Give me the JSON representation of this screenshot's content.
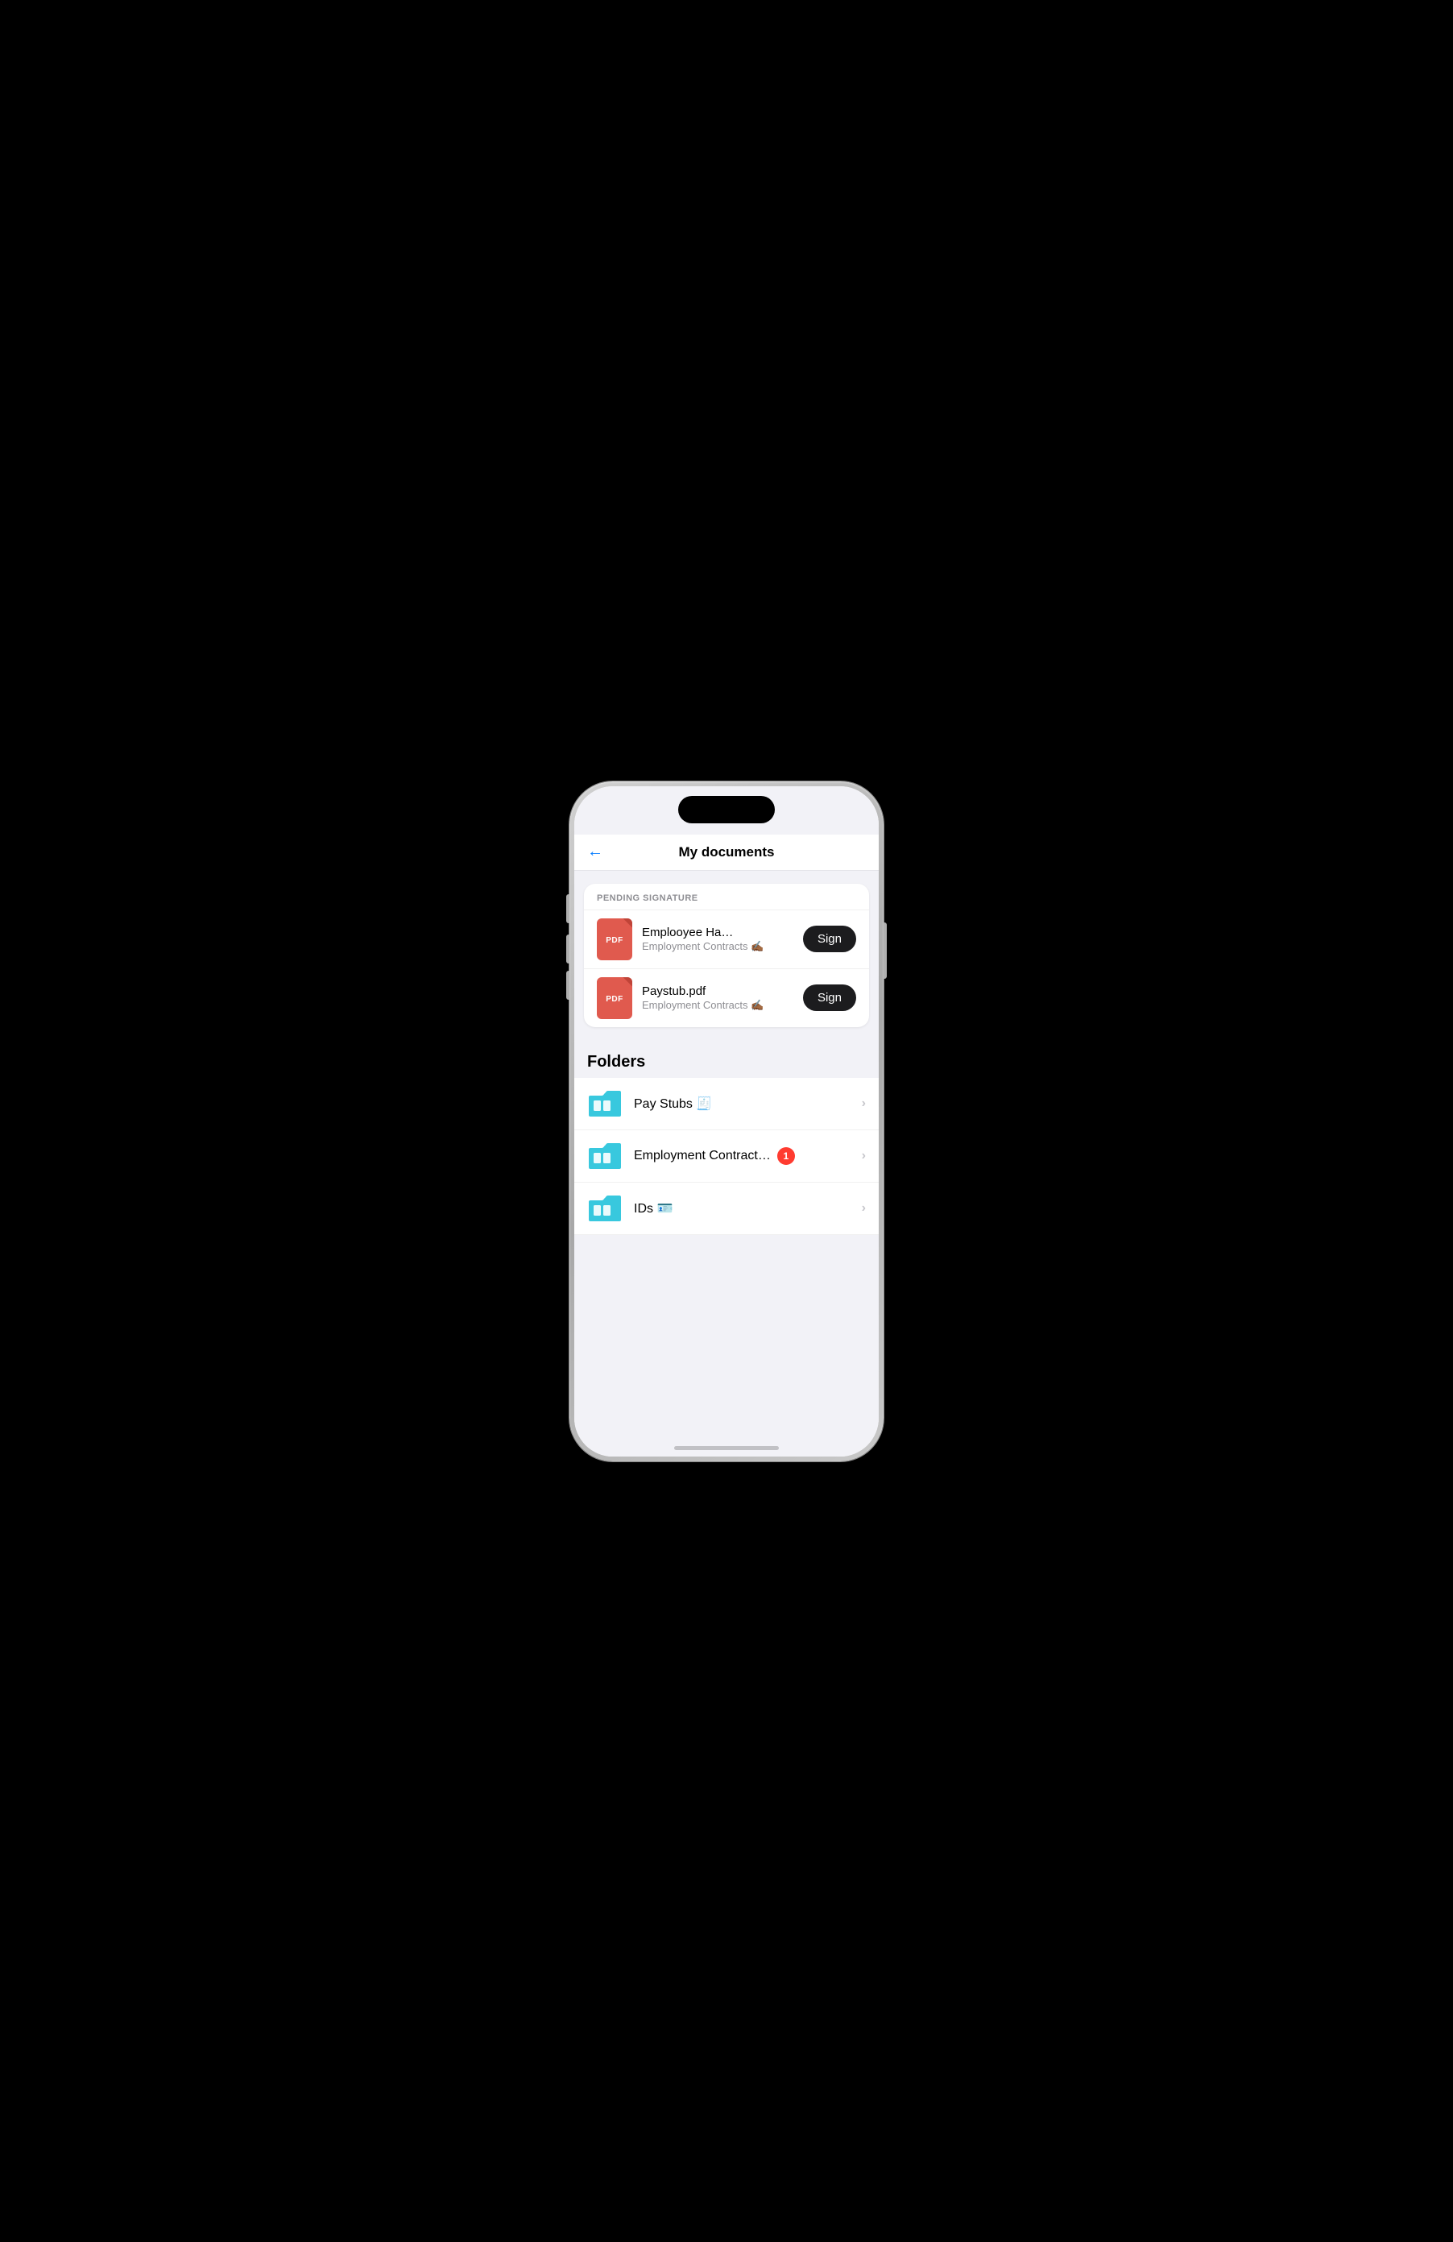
{
  "header": {
    "title": "My documents",
    "back_label": "←"
  },
  "pending_signature": {
    "section_label": "PENDING SIGNATURE",
    "items": [
      {
        "name": "Emplooyee Ha…",
        "subtitle": "Employment Contracts ✍🏾",
        "pdf_label": "PDF",
        "sign_label": "Sign"
      },
      {
        "name": "Paystub.pdf",
        "subtitle": "Employment Contracts ✍🏾",
        "pdf_label": "PDF",
        "sign_label": "Sign"
      }
    ]
  },
  "folders": {
    "section_label": "Folders",
    "items": [
      {
        "name": "Pay Stubs 🧾",
        "badge": null
      },
      {
        "name": "Employment Contract…",
        "badge": "1"
      },
      {
        "name": "IDs 🪪",
        "badge": null
      }
    ]
  }
}
